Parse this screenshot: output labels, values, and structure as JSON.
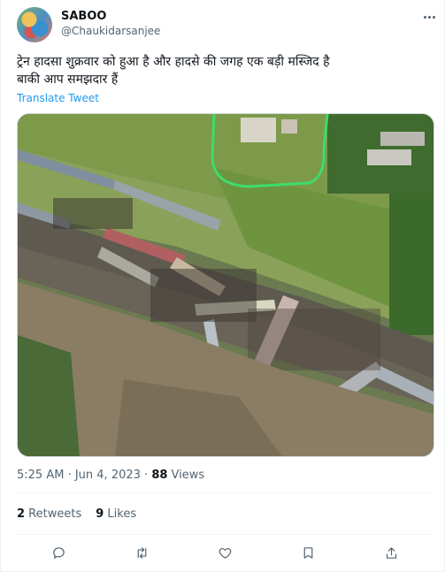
{
  "author": {
    "display_name": "SABOO",
    "handle": "@Chaukidarsanjee"
  },
  "tweet": {
    "text": "ट्रेन हादसा शुक्रवार को हुआ है और हादसे की जगह एक बड़ी मस्जिद है\nबाकी आप समझदार हैं",
    "translate_label": "Translate Tweet",
    "time": "5:25 AM",
    "separator": " · ",
    "date": "Jun 4, 2023",
    "separator2": " · ",
    "views_count": "88",
    "views_label": " Views"
  },
  "stats": {
    "retweets_count": "2",
    "retweets_label": " Retweets",
    "likes_count": "9",
    "likes_label": " Likes"
  },
  "actions": {
    "reply_icon": "reply-icon",
    "retweet_icon": "retweet-icon",
    "like_icon": "heart-icon",
    "bookmark_icon": "bookmark-icon",
    "share_icon": "share-icon"
  },
  "colors": {
    "link": "#1d9bf0",
    "muted": "#536471",
    "text": "#0f1419",
    "highlight_circle": "#3ddc6a"
  }
}
